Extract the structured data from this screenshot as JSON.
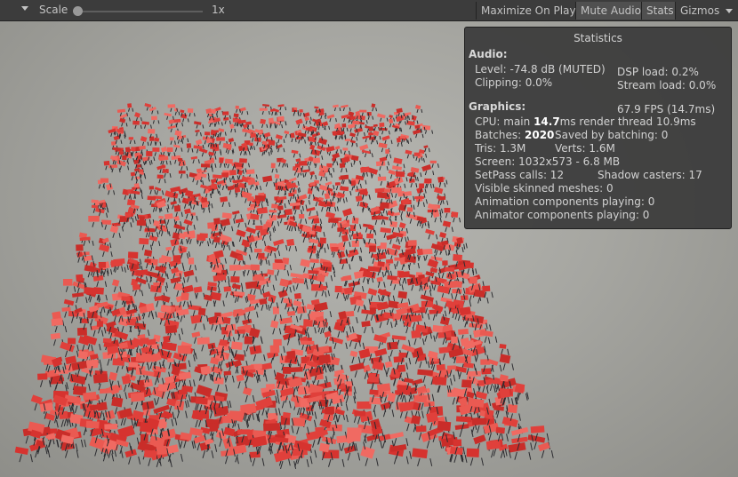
{
  "toolbar": {
    "scale_label": "Scale",
    "scale_value": "1x",
    "scale_slider_position": 0.0,
    "maximize_on_play": "Maximize On Play",
    "mute_audio": "Mute Audio",
    "stats": "Stats",
    "gizmos": "Gizmos"
  },
  "stats_panel": {
    "title": "Statistics",
    "audio_heading": "Audio:",
    "level": "Level: -74.8 dB (MUTED)",
    "dsp_load": "DSP load: 0.2%",
    "clipping": "Clipping: 0.0%",
    "stream_load": "Stream load: 0.0%",
    "graphics_heading": "Graphics:",
    "fps": "67.9 FPS (14.7ms)",
    "cpu_prefix": "CPU: main ",
    "cpu_main": "14.7",
    "cpu_suffix": "ms  render thread 10.9ms",
    "batches_prefix": "Batches: ",
    "batches": "2020",
    "saved_by_batching": "Saved by batching: 0",
    "tris": "Tris: 1.3M",
    "verts": "Verts: 1.6M",
    "screen": "Screen: 1032x573 - 6.8 MB",
    "setpass": "SetPass calls: 12",
    "shadow_casters": "Shadow casters: 17",
    "visible_skinned": "Visible skinned meshes: 0",
    "animation_components": "Animation components playing: 0",
    "animator_components": "Animator components playing: 0"
  },
  "colors": {
    "toolbar_bg": "#3c3c3c",
    "active_button": "#505050",
    "panel_bg": "#3a3a3a",
    "object_red": "#e0403b",
    "object_dark": "#2c2c30"
  },
  "icons": [
    "dropdown-arrow-icon",
    "gizmos-dropdown-icon"
  ]
}
